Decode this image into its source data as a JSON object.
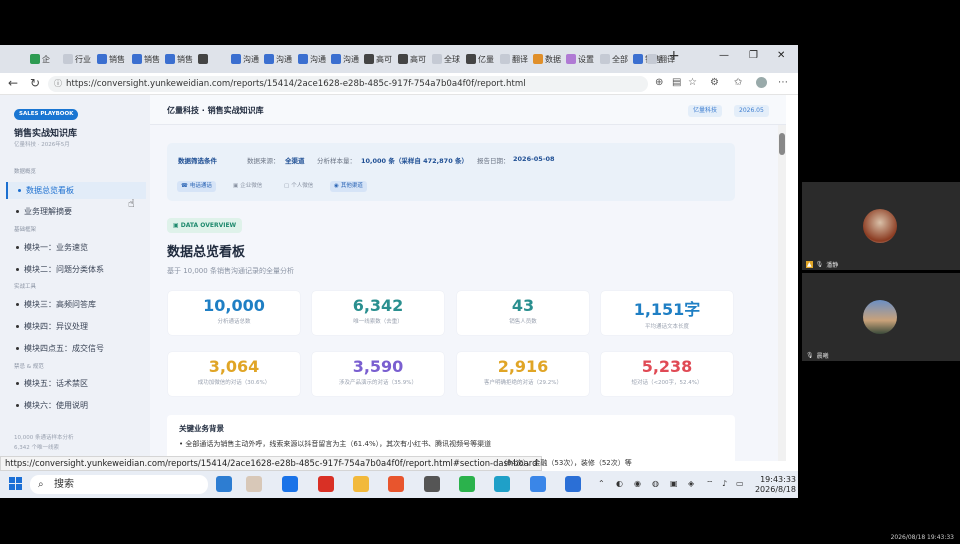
{
  "browser": {
    "tabs": [
      {
        "label": "企",
        "color": "#2e9b52"
      },
      {
        "label": "行业",
        "color": "#c5cad4"
      },
      {
        "label": "销售",
        "color": "#3b6fd0"
      },
      {
        "label": "销售",
        "color": "#3b6fd0"
      },
      {
        "label": "销售",
        "color": "#3b6fd0"
      },
      {
        "label": "",
        "color": "#444"
      },
      {
        "label": "沟通",
        "color": "#3b6fd0"
      },
      {
        "label": "沟通",
        "color": "#3b6fd0"
      },
      {
        "label": "沟通",
        "color": "#3b6fd0"
      },
      {
        "label": "沟通",
        "color": "#3b6fd0"
      },
      {
        "label": "高可",
        "color": "#444"
      },
      {
        "label": "高可",
        "color": "#444"
      },
      {
        "label": "全球",
        "color": "#c5cad4"
      },
      {
        "label": "亿量",
        "color": "#444"
      },
      {
        "label": "翻译",
        "color": "#c5cad4"
      },
      {
        "label": "数据",
        "color": "#e08f2a"
      },
      {
        "label": "设置",
        "color": "#b07ad4"
      },
      {
        "label": "全部",
        "color": "#c5cad4"
      },
      {
        "label": "销售",
        "color": "#3b6fd0"
      },
      {
        "label": "翻译",
        "color": "#c5cad4"
      }
    ],
    "url": "https://conversight.yunkeweidian.com/reports/15414/2ace1628-e28b-485c-917f-754a7b0a4f0f/report.html",
    "status_url": "https://conversight.yunkeweidian.com/reports/15414/2ace1628-e28b-485c-917f-754a7b0a4f0f/report.html#section-dashboard"
  },
  "sidebar": {
    "badge": "SALES PLAYBOOK",
    "title": "销售实战知识库",
    "subtitle": "亿量科技 · 2026年5月",
    "sections": [
      {
        "label": "数据概览",
        "items": [
          {
            "label": "数据总览看板",
            "active": true
          },
          {
            "label": "业务理解摘要",
            "active": false
          }
        ]
      },
      {
        "label": "基础框架",
        "items": [
          {
            "label": "模块一：业务速览",
            "active": false
          },
          {
            "label": "模块二：问题分类体系",
            "active": false
          }
        ]
      },
      {
        "label": "实战工具",
        "items": [
          {
            "label": "模块三：高频问答库",
            "active": false
          },
          {
            "label": "模块四：异议处理",
            "active": false
          },
          {
            "label": "模块四点五：成交信号",
            "active": false
          }
        ]
      },
      {
        "label": "禁忌 & 规范",
        "items": [
          {
            "label": "模块五：话术禁区",
            "active": false
          },
          {
            "label": "模块六：使用说明",
            "active": false
          }
        ]
      }
    ],
    "footer": [
      "10,000 条通话样本分析",
      "6,342 个唯一线索"
    ]
  },
  "header": {
    "title": "亿量科技 · 销售实战知识库",
    "badge_company": "亿量科技",
    "badge_date": "2026.05"
  },
  "filter": {
    "title": "数据筛选条件",
    "source_label": "数据来源：",
    "source_value": "全渠道",
    "sample_label": "分析样本量：",
    "sample_value": "10,000 条（采样自 472,870 条）",
    "date_label": "报告日期：",
    "date_value": "2026-05-08",
    "chips": [
      {
        "icon": "☎",
        "label": "电话通话",
        "selected": true
      },
      {
        "icon": "▣",
        "label": "企业微信",
        "selected": false
      },
      {
        "icon": "▢",
        "label": "个人微信",
        "selected": false
      },
      {
        "icon": "◉",
        "label": "其他渠道",
        "selected": true
      }
    ]
  },
  "overview": {
    "badge": "DATA OVERVIEW",
    "title": "数据总览看板",
    "subtitle": "基于 10,000 条销售沟通记录的全量分析"
  },
  "stats": [
    {
      "value": "10,000",
      "label": "分析通话总数",
      "color": "#1f7fc4"
    },
    {
      "value": "6,342",
      "label": "唯一线索数（去重）",
      "color": "#2a8f8f"
    },
    {
      "value": "43",
      "label": "销售人员数",
      "color": "#2a8f8f"
    },
    {
      "value": "1,151字",
      "label": "平均通话文本长度",
      "color": "#1f7fc4"
    },
    {
      "value": "3,064",
      "label": "成功加微信的对话（30.6%）",
      "color": "#e0a526"
    },
    {
      "value": "3,590",
      "label": "涉及产品演示的对话（35.9%）",
      "color": "#7a5fd0"
    },
    {
      "value": "2,916",
      "label": "客户明确拒绝的对话（29.2%）",
      "color": "#e0a526"
    },
    {
      "value": "5,238",
      "label": "短对话（<200字，52.4%）",
      "color": "#e04a55"
    }
  ],
  "background": {
    "title": "关键业务背景",
    "line": "• 全部通话为销售主动外呼，线索来源以抖音留言为主（61.4%），其次有小红书、腾讯视频号等渠道",
    "partial": "（64次），金融（53次），装修（52次）等"
  },
  "meeting": {
    "participant1": "潘静",
    "participant2": "晨曦"
  },
  "taskbar": {
    "search_placeholder": "搜索",
    "time": "19:43:33",
    "date": "2026/8/18"
  },
  "recording_stamp": "2026/08/18 19:43:33"
}
